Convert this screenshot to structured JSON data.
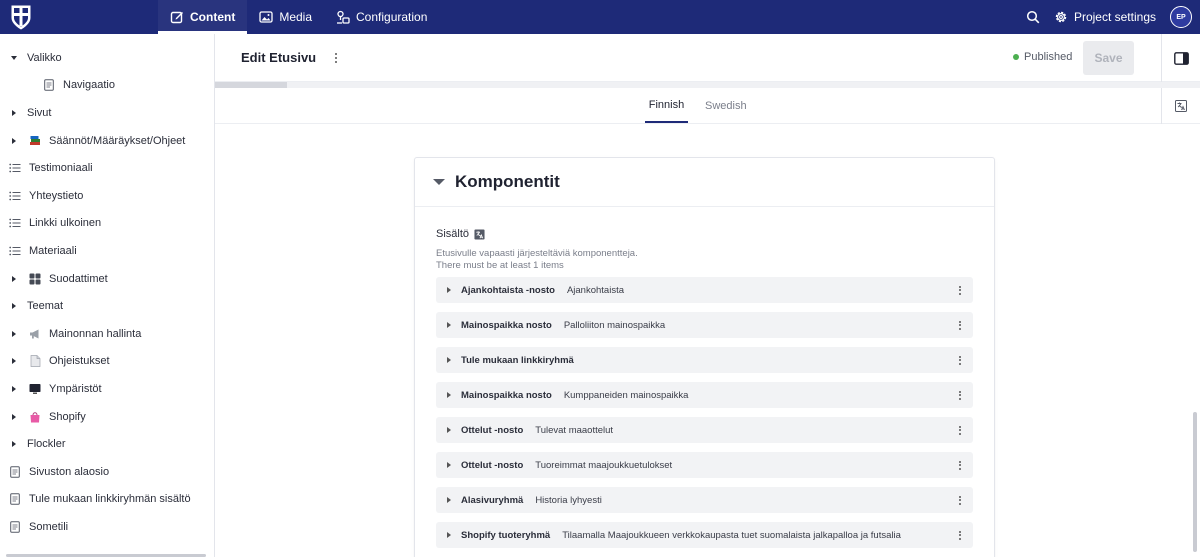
{
  "topbar": {
    "nav": [
      {
        "label": "Content",
        "icon": "edit-icon",
        "active": true
      },
      {
        "label": "Media",
        "icon": "image-icon",
        "active": false
      },
      {
        "label": "Configuration",
        "icon": "configuration-icon",
        "active": false
      }
    ],
    "project_settings_label": "Project settings",
    "avatar_initials": "EP",
    "brand_color": "#1e2a78"
  },
  "sidebar": {
    "items": [
      {
        "label": "Valikko",
        "expander": "expanded",
        "icon": null
      },
      {
        "label": "Navigaatio",
        "expander": "none",
        "icon": "document-icon",
        "child": true
      },
      {
        "label": "Sivut",
        "expander": "collapsed",
        "icon": null
      },
      {
        "label": "Säännöt/Määräykset/Ohjeet",
        "expander": "collapsed",
        "icon": "books-emoji-icon"
      },
      {
        "label": "Testimoniaali",
        "expander": "none",
        "icon": "list-icon"
      },
      {
        "label": "Yhteystieto",
        "expander": "none",
        "icon": "list-icon"
      },
      {
        "label": "Linkki ulkoinen",
        "expander": "none",
        "icon": "list-icon"
      },
      {
        "label": "Materiaali",
        "expander": "none",
        "icon": "list-icon"
      },
      {
        "label": "Suodattimet",
        "expander": "collapsed",
        "icon": "grid-emoji-icon"
      },
      {
        "label": "Teemat",
        "expander": "collapsed",
        "icon": null
      },
      {
        "label": "Mainonnan hallinta",
        "expander": "collapsed",
        "icon": "megaphone-emoji-icon"
      },
      {
        "label": "Ohjeistukset",
        "expander": "collapsed",
        "icon": "page-emoji-icon"
      },
      {
        "label": "Ympäristöt",
        "expander": "collapsed",
        "icon": "monitor-emoji-icon"
      },
      {
        "label": "Shopify",
        "expander": "collapsed",
        "icon": "shopping-bag-emoji-icon"
      },
      {
        "label": "Flockler",
        "expander": "collapsed",
        "icon": null
      },
      {
        "label": "Sivuston alaosio",
        "expander": "none",
        "icon": "document-icon"
      },
      {
        "label": "Tule mukaan linkkiryhmän sisältö",
        "expander": "none",
        "icon": "document-icon"
      },
      {
        "label": "Sometili",
        "expander": "none",
        "icon": "document-icon"
      }
    ]
  },
  "editor": {
    "title": "Edit Etusivu",
    "status": "Published",
    "status_color": "#4caf50",
    "save_label": "Save",
    "tabs": [
      {
        "label": "Finnish",
        "active": true
      },
      {
        "label": "Swedish",
        "active": false
      }
    ]
  },
  "card": {
    "title": "Komponentit",
    "field_label": "Sisältö",
    "field_desc_1": "Etusivulle vapaasti järjesteltäviä komponentteja.",
    "field_desc_2": "There must be at least 1 items",
    "items": [
      {
        "type": "Ajankohtaista -nosto",
        "value": "Ajankohtaista"
      },
      {
        "type": "Mainospaikka nosto",
        "value": "Palloliiton mainospaikka"
      },
      {
        "type": "Tule mukaan linkkiryhmä",
        "value": ""
      },
      {
        "type": "Mainospaikka nosto",
        "value": "Kumppaneiden mainospaikka"
      },
      {
        "type": "Ottelut -nosto",
        "value": "Tulevat maaottelut"
      },
      {
        "type": "Ottelut -nosto",
        "value": "Tuoreimmat maajoukkuetulokset"
      },
      {
        "type": "Alasivuryhmä",
        "value": "Historia lyhyesti"
      },
      {
        "type": "Shopify tuoteryhmä",
        "value": "Tilaamalla Maajoukkueen verkkokaupasta tuet suomalaista jalkapalloa ja futsalia"
      }
    ]
  }
}
